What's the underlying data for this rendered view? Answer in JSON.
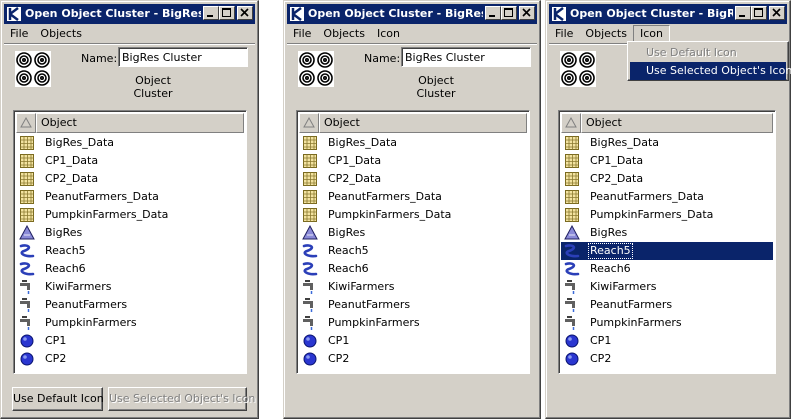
{
  "colors": {
    "titlebar": "#0a246a",
    "face": "#d4d0c8",
    "selection": "#0a246a"
  },
  "windows": [
    {
      "title": "Open Object Cluster - BigRes",
      "menu": [
        "File",
        "Objects"
      ],
      "name_label": "Name:",
      "name_value": "BigRes Cluster",
      "subtitle": "Object Cluster",
      "column_header": "Object",
      "buttons": {
        "default_icon": "Use Default Icon",
        "selected_icon": "Use Selected Object's Icon"
      }
    },
    {
      "title": "Open Object Cluster - BigRes",
      "menu": [
        "File",
        "Objects",
        "Icon"
      ],
      "name_label": "Name:",
      "name_value": "BigRes Cluster",
      "subtitle": "Object Cluster",
      "column_header": "Object"
    },
    {
      "title": "Open Object Cluster - BigRes",
      "menu": [
        "File",
        "Objects",
        "Icon"
      ],
      "column_header": "Object",
      "selected_row": "Reach5",
      "dropdown": {
        "default_icon": "Use Default Icon",
        "selected_icon": "Use Selected Object's Icon"
      }
    }
  ],
  "objects": [
    {
      "name": "BigRes_Data",
      "icon": "data-grid-icon"
    },
    {
      "name": "CP1_Data",
      "icon": "data-grid-icon"
    },
    {
      "name": "CP2_Data",
      "icon": "data-grid-icon"
    },
    {
      "name": "PeanutFarmers_Data",
      "icon": "data-grid-icon"
    },
    {
      "name": "PumpkinFarmers_Data",
      "icon": "data-grid-icon"
    },
    {
      "name": "BigRes",
      "icon": "reservoir-icon"
    },
    {
      "name": "Reach5",
      "icon": "reach-icon"
    },
    {
      "name": "Reach6",
      "icon": "reach-icon"
    },
    {
      "name": "KiwiFarmers",
      "icon": "faucet-icon"
    },
    {
      "name": "PeanutFarmers",
      "icon": "faucet-icon"
    },
    {
      "name": "PumpkinFarmers",
      "icon": "faucet-icon"
    },
    {
      "name": "CP1",
      "icon": "control-point-icon"
    },
    {
      "name": "CP2",
      "icon": "control-point-icon"
    }
  ]
}
